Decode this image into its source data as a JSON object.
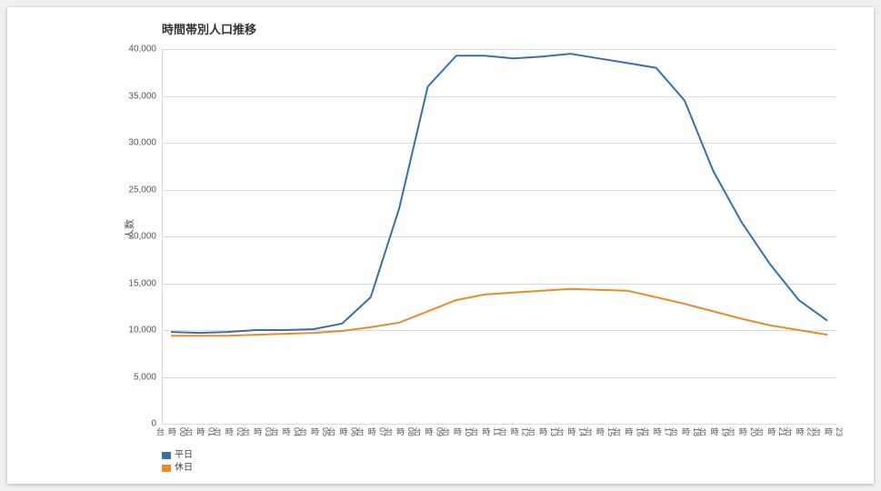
{
  "chart_data": {
    "type": "line",
    "title": "時間帯別人口推移",
    "ylabel": "人数",
    "xlabel": "",
    "ylim": [
      0,
      40000
    ],
    "yticks": [
      0,
      5000,
      10000,
      15000,
      20000,
      25000,
      30000,
      35000,
      40000
    ],
    "ytick_labels": [
      "0",
      "5,000",
      "10,000",
      "15,000",
      "20,000",
      "25,000",
      "30,000",
      "35,000",
      "40,000"
    ],
    "categories": [
      "00時台",
      "01時台",
      "02時台",
      "03時台",
      "04時台",
      "05時台",
      "06時台",
      "07時台",
      "08時台",
      "09時台",
      "10時台",
      "11時台",
      "12時台",
      "13時台",
      "14時台",
      "15時台",
      "16時台",
      "17時台",
      "18時台",
      "19時台",
      "20時台",
      "21時台",
      "22時台",
      "23時台"
    ],
    "series": [
      {
        "name": "平日",
        "color": "#3a6fa7",
        "values": [
          9800,
          9700,
          9800,
          10000,
          10000,
          10100,
          10700,
          13500,
          23000,
          36000,
          39300,
          39300,
          39000,
          39200,
          39500,
          39000,
          38500,
          38000,
          34500,
          27000,
          21500,
          17000,
          13200,
          11000
        ]
      },
      {
        "name": "休日",
        "color": "#e88b2d",
        "values": [
          9400,
          9400,
          9400,
          9500,
          9600,
          9700,
          9900,
          10300,
          10800,
          12000,
          13200,
          13800,
          14000,
          14200,
          14400,
          14300,
          14200,
          13500,
          12800,
          12000,
          11200,
          10500,
          10000,
          9500
        ]
      }
    ],
    "legend_position": "bottom-left"
  }
}
